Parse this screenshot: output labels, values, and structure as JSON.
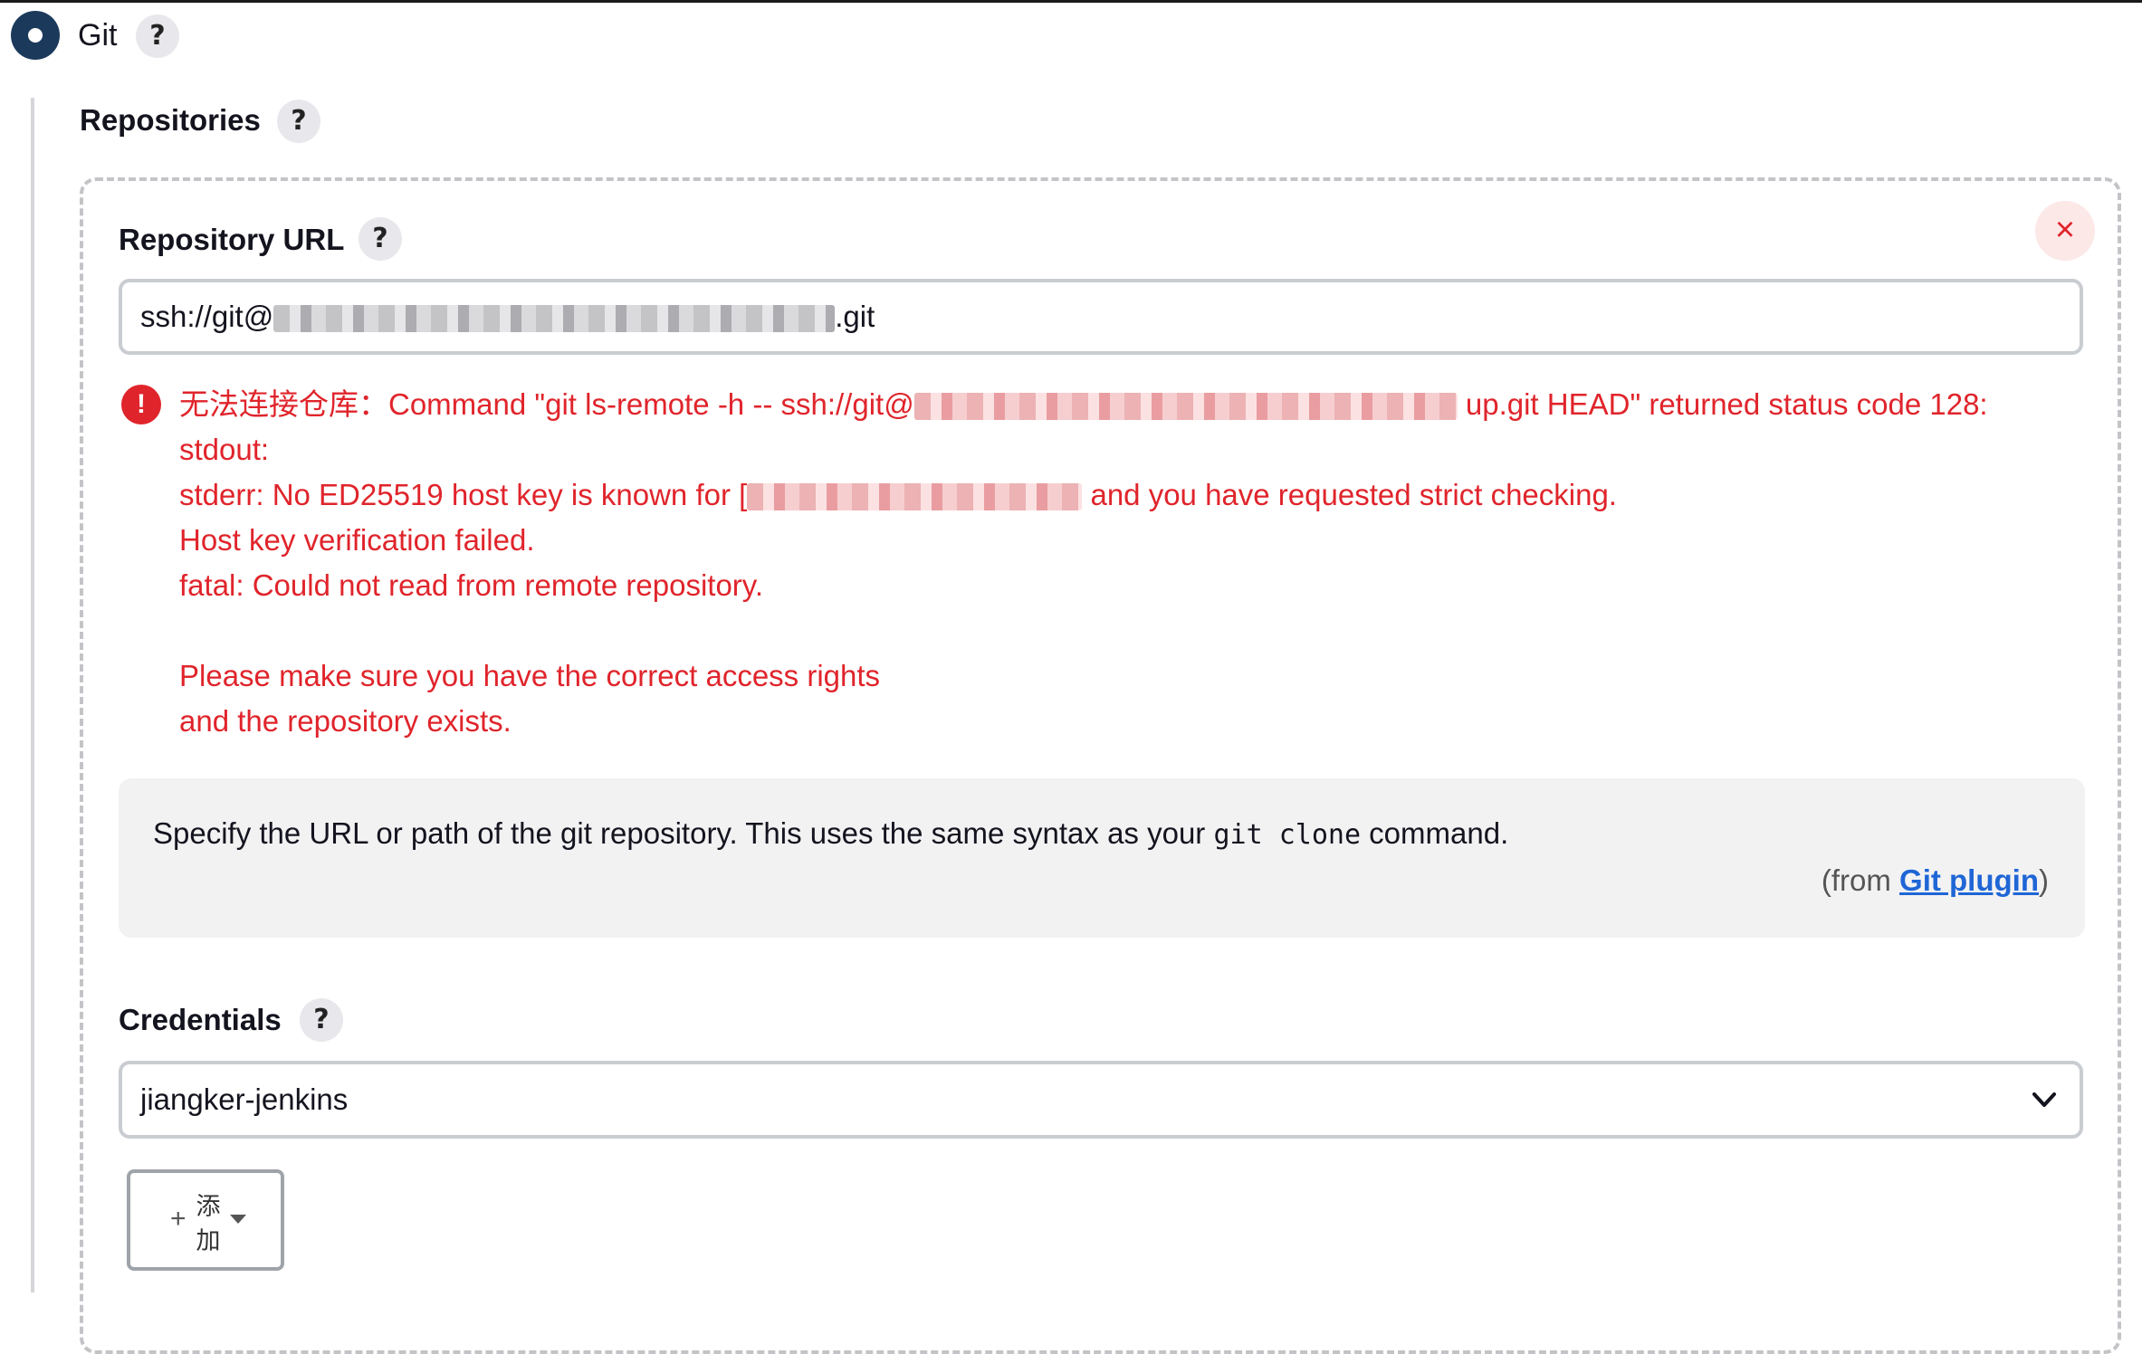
{
  "scm": {
    "label": "Git",
    "help": "?"
  },
  "repositories": {
    "title": "Repositories",
    "help": "?"
  },
  "repo_url": {
    "label": "Repository URL",
    "help": "?",
    "value_prefix": "ssh://git@",
    "value_suffix": ".git",
    "close_symbol": "×"
  },
  "error": {
    "icon": "!",
    "line1_prefix": "无法连接仓库：Command \"git ls-remote -h -- ssh://git@",
    "line1_suffix": "up.git HEAD\" returned status code 128:",
    "line2": "stdout:",
    "line3_prefix": "stderr: No ED25519 host key is known for [",
    "line3_suffix": " and you have requested strict checking.",
    "line4": "Host key verification failed.",
    "line5": "fatal: Could not read from remote repository.",
    "line6": "Please make sure you have the correct access rights",
    "line7": "and the repository exists."
  },
  "help_box": {
    "text_before": "Specify the URL or path of the git repository. This uses the same syntax as your ",
    "code": "git clone",
    "text_after": " command.",
    "from_prefix": "(from ",
    "from_link": "Git plugin",
    "from_suffix": ")"
  },
  "credentials": {
    "label": "Credentials",
    "help": "?",
    "selected": "jiangker-jenkins"
  },
  "add_button": {
    "plus": "+",
    "label": "添加"
  },
  "icons": {
    "radio": "radio-selected-icon",
    "help": "question-circle-icon",
    "close": "close-icon",
    "error": "error-circle-icon",
    "chevron": "chevron-down-icon",
    "plus": "plus-icon",
    "caret": "caret-down-icon"
  },
  "colors": {
    "error": "#e0242b",
    "link": "#1f66d6",
    "radio": "#1b3a5b"
  }
}
